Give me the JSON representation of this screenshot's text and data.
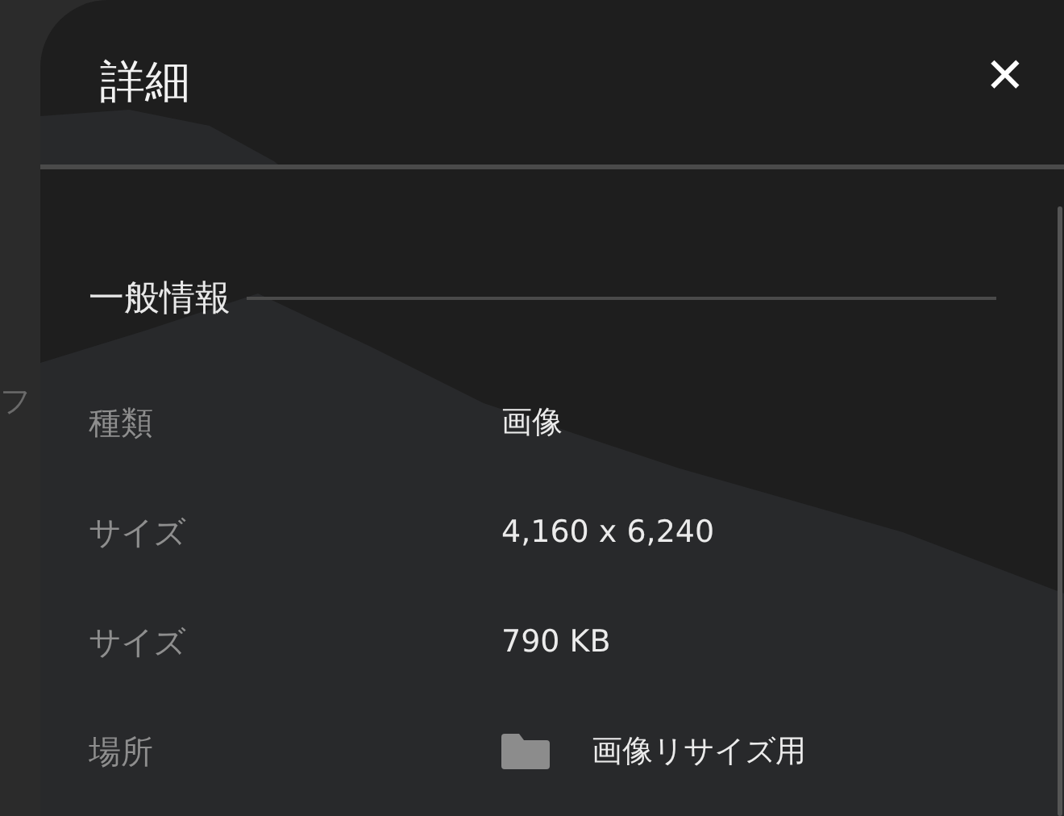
{
  "background_page": {
    "texts": [
      "フ"
    ]
  },
  "panel": {
    "title": "詳細",
    "close_label": "✕",
    "section": {
      "title": "一般情報",
      "rows": [
        {
          "kind": "text",
          "label": "種類",
          "value": "画像"
        },
        {
          "kind": "text",
          "label": "サイズ",
          "value": "4,160 x 6,240"
        },
        {
          "kind": "text",
          "label": "サイズ",
          "value": "790 KB"
        },
        {
          "kind": "folder",
          "label": "場所",
          "value": "画像リサイズ用"
        }
      ]
    }
  }
}
